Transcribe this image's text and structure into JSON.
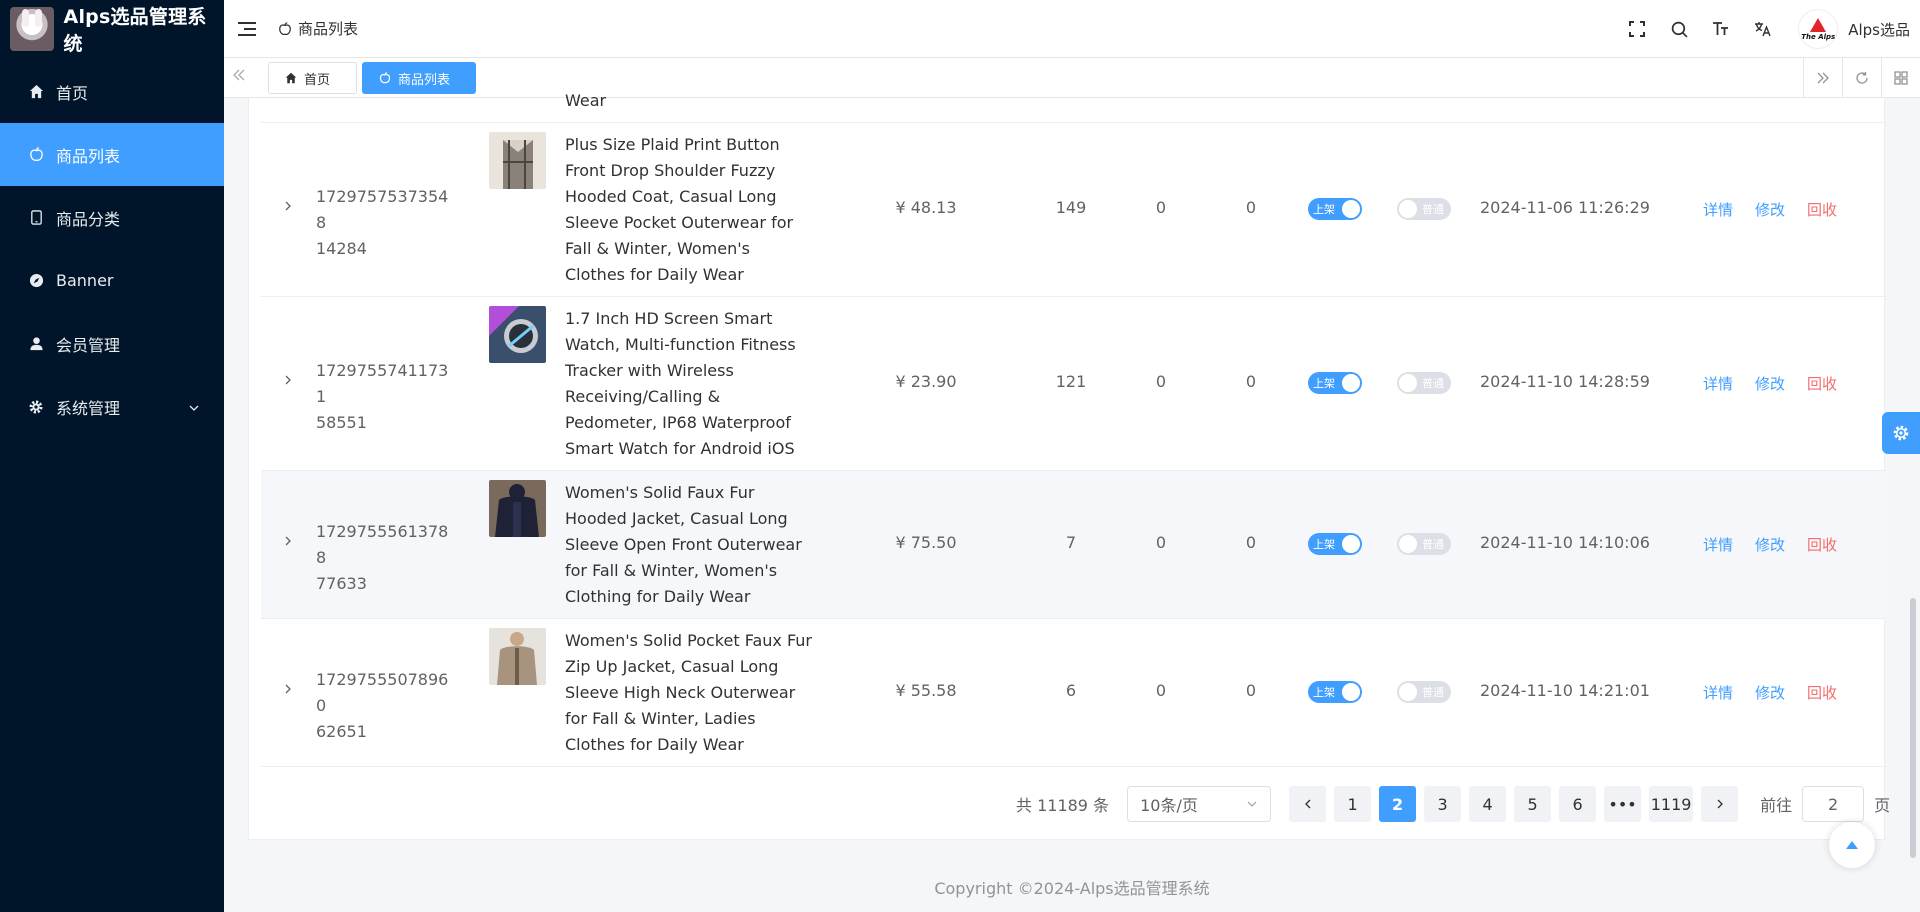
{
  "app": {
    "title": "Alps选品管理系统"
  },
  "sidebar": {
    "items": [
      {
        "label": "首页",
        "icon": "home-icon"
      },
      {
        "label": "商品列表",
        "icon": "apple-icon",
        "active": true
      },
      {
        "label": "商品分类",
        "icon": "tablet-icon"
      },
      {
        "label": "Banner",
        "icon": "compass-icon"
      },
      {
        "label": "会员管理",
        "icon": "user-icon"
      },
      {
        "label": "系统管理",
        "icon": "gear-icon",
        "has_submenu": true
      }
    ]
  },
  "header": {
    "breadcrumb": "商品列表",
    "avatar_text": "The Alps",
    "user_name": "Alps选品"
  },
  "tabs": [
    {
      "label": "首页",
      "icon": "home-icon"
    },
    {
      "label": "商品列表",
      "icon": "apple-icon",
      "active": true
    }
  ],
  "table": {
    "partial_row_tail": "Wear",
    "rows": [
      {
        "id": "1729757537354814284",
        "id_line1": "17297575373548",
        "id_line2": "14284",
        "name": "Plus Size Plaid Print Button Front Drop Shoulder Fuzzy Hooded Coat, Casual Long Sleeve Pocket Outerwear for Fall & Winter, Women's Clothes for Daily Wear",
        "price": "¥ 48.13",
        "stock": "149",
        "v1": "0",
        "v2": "0",
        "on_shelf_label": "上架",
        "on_shelf": true,
        "type_label": "普通",
        "type_on": false,
        "date": "2024-11-06 11:26:29",
        "thumb_color": "#8a8178"
      },
      {
        "id": "1729755741173158551",
        "id_line1": "17297557411731",
        "id_line2": "58551",
        "name": "1.7 Inch HD Screen Smart Watch, Multi-function Fitness Tracker with Wireless Receiving/Calling & Pedometer, IP68 Waterproof Smart Watch for Android iOS",
        "price": "¥ 23.90",
        "stock": "121",
        "v1": "0",
        "v2": "0",
        "on_shelf_label": "上架",
        "on_shelf": true,
        "type_label": "普通",
        "type_on": false,
        "date": "2024-11-10 14:28:59",
        "thumb_color": "#3a4f6b"
      },
      {
        "id": "1729755561378877633",
        "id_line1": "17297555613788",
        "id_line2": "77633",
        "name": "Women's Solid Faux Fur Hooded Jacket, Casual Long Sleeve Open Front Outerwear for Fall & Winter, Women's Clothing for Daily Wear",
        "price": "¥ 75.50",
        "stock": "7",
        "v1": "0",
        "v2": "0",
        "on_shelf_label": "上架",
        "on_shelf": true,
        "type_label": "普通",
        "type_on": false,
        "date": "2024-11-10 14:10:06",
        "thumb_color": "#1f2236"
      },
      {
        "id": "1729755507896062651",
        "id_line1": "17297555078960",
        "id_line2": "62651",
        "name": "Women's Solid Pocket Faux Fur Zip Up Jacket, Casual Long Sleeve High Neck Outerwear for Fall & Winter, Ladies Clothes for Daily Wear",
        "price": "¥ 55.58",
        "stock": "6",
        "v1": "0",
        "v2": "0",
        "on_shelf_label": "上架",
        "on_shelf": true,
        "type_label": "普通",
        "type_on": false,
        "date": "2024-11-10 14:21:01",
        "thumb_color": "#a8937f"
      }
    ],
    "actions": {
      "detail": "详情",
      "edit": "修改",
      "recycle": "回收"
    }
  },
  "pagination": {
    "total_text": "共 11189 条",
    "page_size": "10条/页",
    "pages": [
      "1",
      "2",
      "3",
      "4",
      "5",
      "6",
      "•••",
      "1119"
    ],
    "current": "2",
    "goto_label": "前往",
    "goto_value": "2",
    "goto_suffix": "页"
  },
  "footer": {
    "copyright": "Copyright ©2024-Alps选品管理系统"
  },
  "colors": {
    "primary": "#409eff",
    "danger": "#f56c6c",
    "sidebar_bg": "#001529"
  }
}
